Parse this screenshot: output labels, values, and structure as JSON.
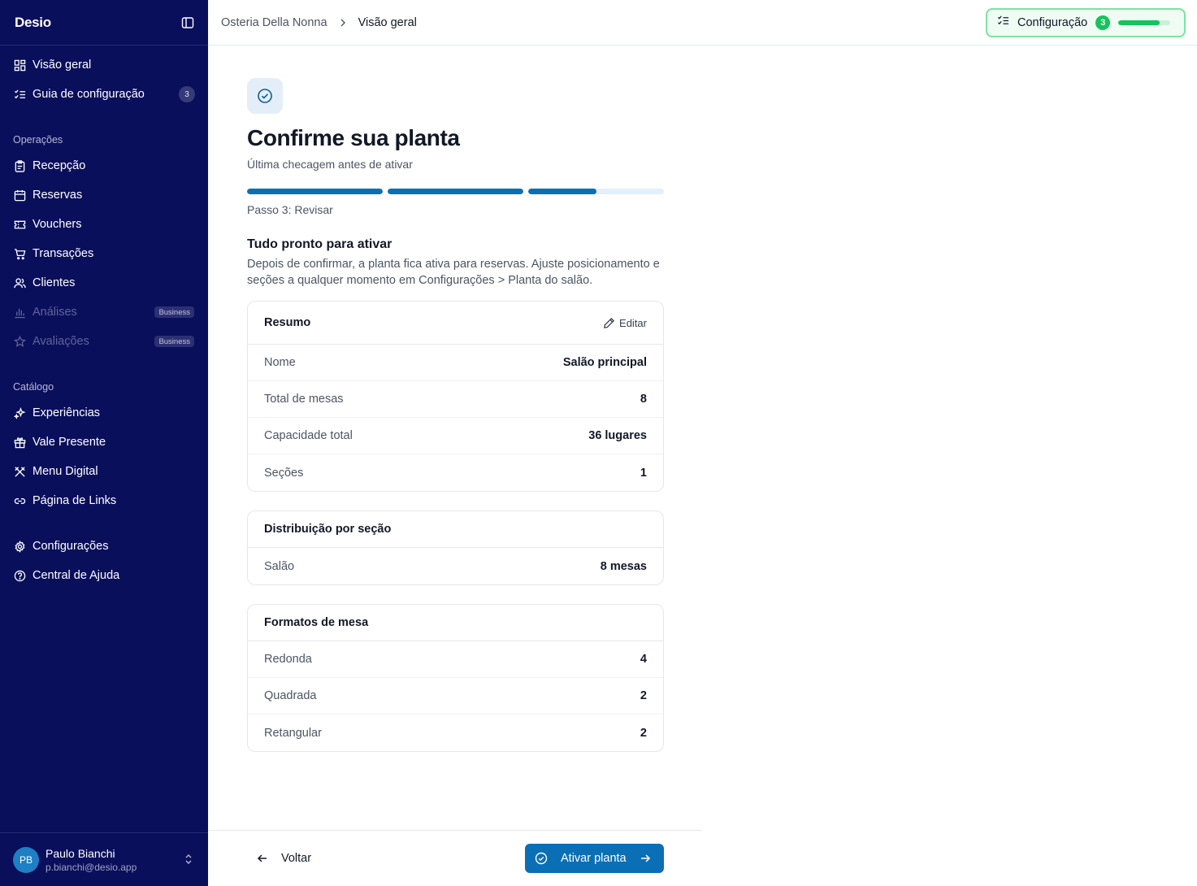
{
  "brand": {
    "logo": "Desio"
  },
  "sidebar": {
    "items_top": [
      {
        "label": "Visão geral",
        "icon": "grid-icon"
      },
      {
        "label": "Guia de configuração",
        "icon": "checklist-icon",
        "badge": "3"
      }
    ],
    "section_ops": "Operações",
    "items_ops": [
      {
        "label": "Recepção",
        "icon": "clipboard-icon"
      },
      {
        "label": "Reservas",
        "icon": "calendar-icon"
      },
      {
        "label": "Vouchers",
        "icon": "ticket-icon"
      },
      {
        "label": "Transações",
        "icon": "cart-icon"
      },
      {
        "label": "Clientes",
        "icon": "users-icon"
      },
      {
        "label": "Análises",
        "icon": "bar-chart-icon",
        "badge": "Business",
        "disabled": true
      },
      {
        "label": "Avaliações",
        "icon": "star-icon",
        "badge": "Business",
        "disabled": true
      }
    ],
    "section_catalog": "Catálogo",
    "items_catalog": [
      {
        "label": "Experiências",
        "icon": "sparkles-icon"
      },
      {
        "label": "Vale Presente",
        "icon": "gift-icon"
      },
      {
        "label": "Menu Digital",
        "icon": "utensils-icon"
      },
      {
        "label": "Página de Links",
        "icon": "link-icon"
      }
    ],
    "items_bottom": [
      {
        "label": "Configurações",
        "icon": "gear-icon"
      },
      {
        "label": "Central de Ajuda",
        "icon": "help-circle-icon"
      }
    ],
    "user": {
      "initials": "PB",
      "name": "Paulo Bianchi",
      "email": "p.bianchi@desio.app"
    }
  },
  "header": {
    "breadcrumb": [
      "Osteria Della Nonna",
      "Visão geral"
    ],
    "config": {
      "label": "Configuração",
      "count": "3",
      "progress": 0.8
    }
  },
  "main": {
    "title": "Confirme sua planta",
    "subtitle": "Última checagem antes de ativar",
    "steps_progress": [
      1,
      1,
      0.5
    ],
    "step_label": "Passo 3: Revisar",
    "ready_title": "Tudo pronto para ativar",
    "ready_text": "Depois de confirmar, a planta fica ativa para reservas. Ajuste posicionamento e seções a qualquer momento em Configurações > Planta do salão.",
    "summary": {
      "title": "Resumo",
      "edit_label": "Editar",
      "rows": [
        {
          "key": "Nome",
          "value": "Salão principal"
        },
        {
          "key": "Total de mesas",
          "value": "8"
        },
        {
          "key": "Capacidade total",
          "value": "36 lugares"
        },
        {
          "key": "Seções",
          "value": "1"
        }
      ]
    },
    "distribution": {
      "title": "Distribuição por seção",
      "rows": [
        {
          "key": "Salão",
          "value": "8 mesas"
        }
      ]
    },
    "formats": {
      "title": "Formatos de mesa",
      "rows": [
        {
          "key": "Redonda",
          "value": "4"
        },
        {
          "key": "Quadrada",
          "value": "2"
        },
        {
          "key": "Retangular",
          "value": "2"
        }
      ]
    }
  },
  "footer": {
    "back_label": "Voltar",
    "primary_label": "Ativar planta"
  },
  "colors": {
    "sidebar_bg": "#0a0f5c",
    "primary": "#0b6fb5",
    "success": "#16c35c"
  }
}
